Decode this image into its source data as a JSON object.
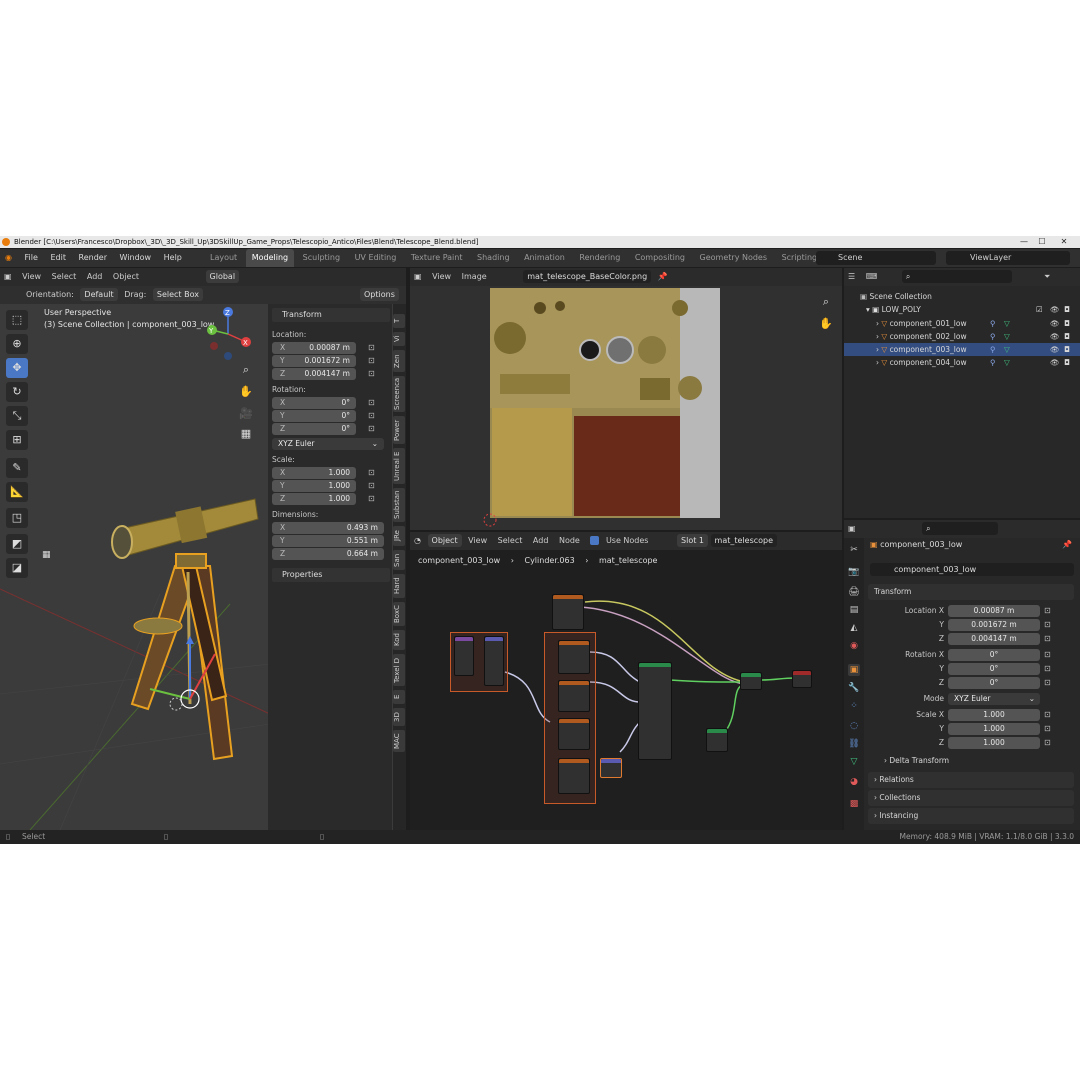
{
  "window": {
    "title": "Blender [C:\\Users\\Francesco\\Dropbox\\_3D\\_3D_Skill_Up\\3DSkillUp_Game_Props\\Telescopio_Antico\\Files\\Blend\\Telescope_Blend.blend]",
    "controls": [
      "—",
      "☐",
      "✕"
    ]
  },
  "menu": {
    "items": [
      "File",
      "Edit",
      "Render",
      "Window",
      "Help"
    ]
  },
  "workspaces": {
    "tabs": [
      "Layout",
      "Modeling",
      "Sculpting",
      "UV Editing",
      "Texture Paint",
      "Shading",
      "Animation",
      "Rendering",
      "Compositing",
      "Geometry Nodes",
      "Scripting"
    ],
    "active": "Modeling",
    "add": "+"
  },
  "scene": {
    "label": "Scene",
    "view_layer": "ViewLayer"
  },
  "viewport": {
    "menu": [
      "View",
      "Select",
      "Add",
      "Object"
    ],
    "transform_space": "Global",
    "orientation_label": "Orientation:",
    "orientation_value": "Default",
    "drag_label": "Drag:",
    "drag_value": "Select Box",
    "options": "Options",
    "overlay_title": "User Perspective",
    "overlay_subtitle": "(3) Scene Collection | component_003_low"
  },
  "npanel": {
    "header": "Transform",
    "location_label": "Location:",
    "location": [
      {
        "axis": "X",
        "value": "0.00087 m"
      },
      {
        "axis": "Y",
        "value": "0.001672 m"
      },
      {
        "axis": "Z",
        "value": "0.004147 m"
      }
    ],
    "rotation_label": "Rotation:",
    "rotation": [
      {
        "axis": "X",
        "value": "0°"
      },
      {
        "axis": "Y",
        "value": "0°"
      },
      {
        "axis": "Z",
        "value": "0°"
      }
    ],
    "rotation_mode": "XYZ Euler",
    "scale_label": "Scale:",
    "scale": [
      {
        "axis": "X",
        "value": "1.000"
      },
      {
        "axis": "Y",
        "value": "1.000"
      },
      {
        "axis": "Z",
        "value": "1.000"
      }
    ],
    "dimensions_label": "Dimensions:",
    "dimensions": [
      {
        "axis": "X",
        "value": "0.493 m"
      },
      {
        "axis": "Y",
        "value": "0.551 m"
      },
      {
        "axis": "Z",
        "value": "0.664 m"
      }
    ],
    "properties": "Properties",
    "tabs": [
      "T",
      "Vi",
      "Zen",
      "Screenca",
      "Power",
      "Unreal E",
      "Substan",
      "JRe",
      "San",
      "Hard",
      "BoxC",
      "Kod",
      "Texel D",
      "E",
      "3D",
      "MAC"
    ]
  },
  "image_editor": {
    "menu": [
      "View",
      "Image"
    ],
    "image_name": "mat_telescope_BaseColor.png"
  },
  "node_editor": {
    "object_mode": "Object",
    "menu": [
      "View",
      "Select",
      "Add",
      "Node"
    ],
    "use_nodes": "Use Nodes",
    "slot": "Slot 1",
    "material": "mat_telescope",
    "breadcrumb": [
      "component_003_low",
      "Cylinder.063",
      "mat_telescope"
    ]
  },
  "outliner": {
    "scene_collection": "Scene Collection",
    "collection": "LOW_POLY",
    "items": [
      "component_001_low",
      "component_002_low",
      "component_003_low",
      "component_004_low"
    ],
    "selected_index": 2
  },
  "properties": {
    "object_name": "component_003_low",
    "data_name": "component_003_low",
    "transform_header": "Transform",
    "location": [
      {
        "label": "Location X",
        "value": "0.00087 m"
      },
      {
        "label": "Y",
        "value": "0.001672 m"
      },
      {
        "label": "Z",
        "value": "0.004147 m"
      }
    ],
    "rotation": [
      {
        "label": "Rotation X",
        "value": "0°"
      },
      {
        "label": "Y",
        "value": "0°"
      },
      {
        "label": "Z",
        "value": "0°"
      }
    ],
    "mode_label": "Mode",
    "mode_value": "XYZ Euler",
    "scale": [
      {
        "label": "Scale X",
        "value": "1.000"
      },
      {
        "label": "Y",
        "value": "1.000"
      },
      {
        "label": "Z",
        "value": "1.000"
      }
    ],
    "delta_transform": "Delta Transform",
    "sections": [
      "Relations",
      "Collections",
      "Instancing"
    ]
  },
  "statusbar": {
    "left": "Select",
    "right": "Memory: 408.9 MiB | VRAM: 1.1/8.0 GiB | 3.3.0"
  },
  "colors": {
    "accent": "#4a78c4",
    "selected_row": "#334d80",
    "orange_select": "#e8a020",
    "bg": "#1d1d1d"
  }
}
